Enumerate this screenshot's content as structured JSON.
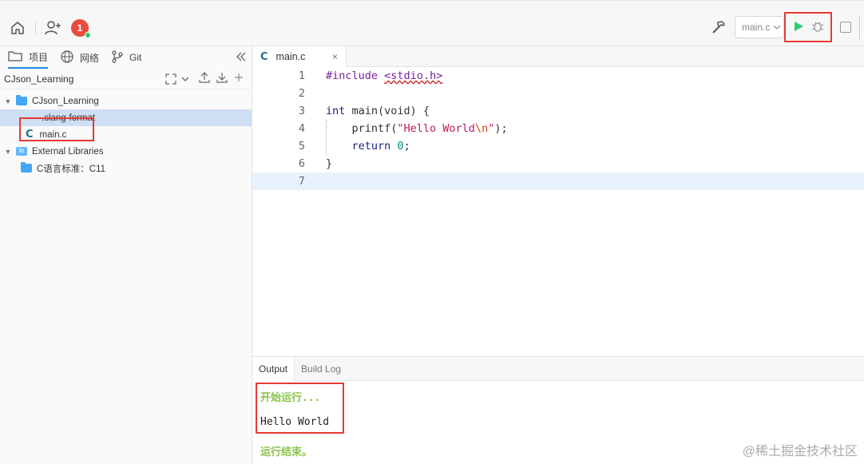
{
  "colors": {
    "accent": "#1e88e5",
    "run_green": "#2ecc71",
    "highlight_red": "#e53935",
    "output_green": "#8bc34a"
  },
  "toolbar": {
    "notification_count": "1",
    "target_select": "main.c"
  },
  "sidebar": {
    "tabs": [
      {
        "label": "项目",
        "icon": "folder-icon"
      },
      {
        "label": "网络",
        "icon": "globe-icon"
      },
      {
        "label": "Git",
        "icon": "git-branch-icon"
      }
    ],
    "project_name": "CJson_Learning",
    "tree": [
      {
        "label": "CJson_Learning",
        "icon": "folder-icon"
      },
      {
        "label": ".clang-format",
        "icon": "file-icon"
      },
      {
        "label": "main.c",
        "icon": "c-file-icon"
      },
      {
        "label": "External Libraries",
        "icon": "library-icon"
      },
      {
        "label": "C语言标准：C11",
        "icon": "folder-icon"
      }
    ]
  },
  "editor": {
    "tab_label": "main.c",
    "tab_close": "×",
    "lines": [
      {
        "n": "1"
      },
      {
        "n": "2"
      },
      {
        "n": "3"
      },
      {
        "n": "4"
      },
      {
        "n": "5"
      },
      {
        "n": "6"
      },
      {
        "n": "7"
      }
    ],
    "code": {
      "l1_directive": "#include",
      "l1_header": "<stdio.h>",
      "l3_type": "int",
      "l3_rest": " main(void) {",
      "l4_fn": "    printf(",
      "l4_str": "\"Hello World",
      "l4_esc": "\\n",
      "l4_strend": "\"",
      "l4_end": ");",
      "l5_kw": "    return",
      "l5_num": "0",
      "l5_end": ";",
      "l6": "}"
    }
  },
  "output": {
    "tabs": [
      "Output",
      "Build Log"
    ],
    "start": "开始运行...",
    "hello": "Hello World",
    "end": "运行结束。"
  },
  "watermark": "@稀土掘金技术社区"
}
